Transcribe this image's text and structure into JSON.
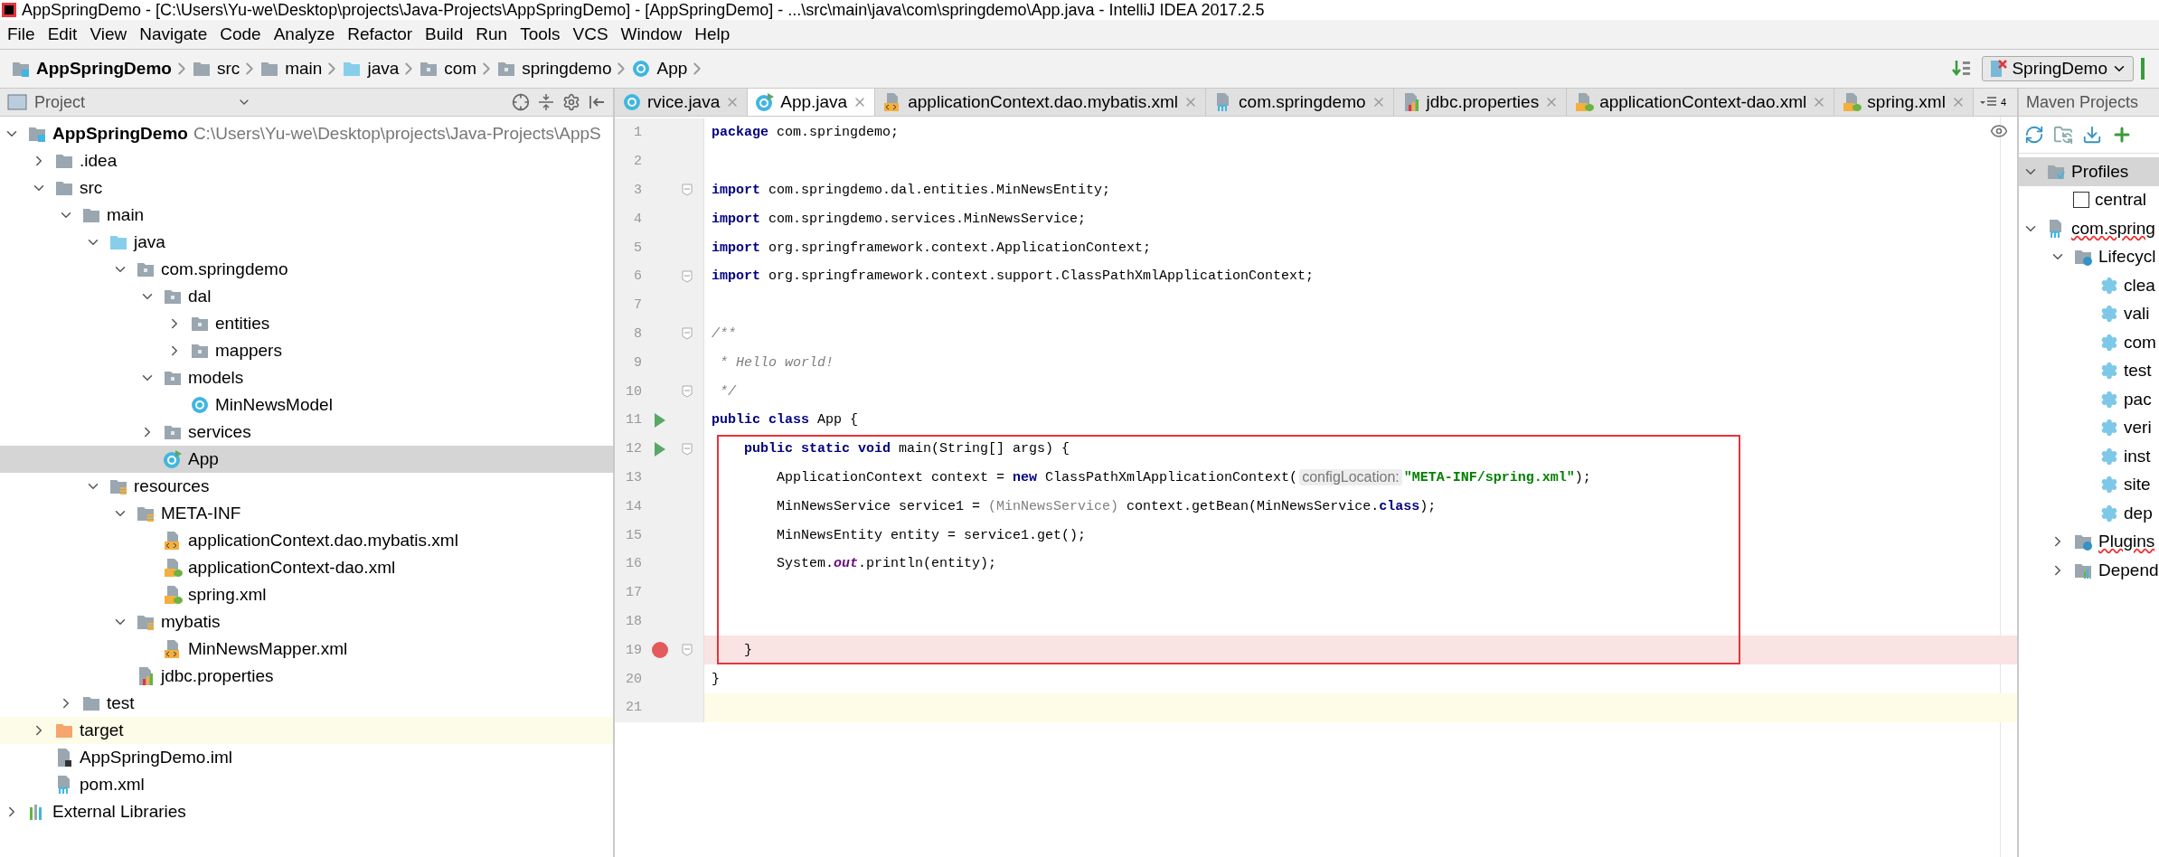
{
  "window": {
    "title": "AppSpringDemo - [C:\\Users\\Yu-we\\Desktop\\projects\\Java-Projects\\AppSpringDemo] - [AppSpringDemo] - ...\\src\\main\\java\\com\\springdemo\\App.java - IntelliJ IDEA 2017.2.5"
  },
  "menu": [
    "File",
    "Edit",
    "View",
    "Navigate",
    "Code",
    "Analyze",
    "Refactor",
    "Build",
    "Run",
    "Tools",
    "VCS",
    "Window",
    "Help"
  ],
  "breadcrumb": [
    {
      "label": "AppSpringDemo",
      "kind": "module"
    },
    {
      "label": "src",
      "kind": "folder"
    },
    {
      "label": "main",
      "kind": "folder"
    },
    {
      "label": "java",
      "kind": "source-root"
    },
    {
      "label": "com",
      "kind": "package"
    },
    {
      "label": "springdemo",
      "kind": "package"
    },
    {
      "label": "App",
      "kind": "class"
    }
  ],
  "run_config": {
    "label": "SpringDemo"
  },
  "project_panel": {
    "title": "Project",
    "tree": [
      {
        "name": "AppSpringDemo",
        "path": "C:\\Users\\Yu-we\\Desktop\\projects\\Java-Projects\\AppS",
        "kind": "module",
        "expanded": true,
        "selected": false,
        "children": [
          {
            "name": ".idea",
            "kind": "folder",
            "expanded": false,
            "selected": false
          },
          {
            "name": "src",
            "kind": "folder",
            "expanded": true,
            "selected": false,
            "children": [
              {
                "name": "main",
                "kind": "folder",
                "expanded": true,
                "selected": false,
                "children": [
                  {
                    "name": "java",
                    "kind": "source-root",
                    "expanded": true,
                    "selected": false,
                    "children": [
                      {
                        "name": "com.springdemo",
                        "kind": "package",
                        "expanded": true,
                        "selected": false,
                        "children": [
                          {
                            "name": "dal",
                            "kind": "package",
                            "expanded": true,
                            "selected": false,
                            "children": [
                              {
                                "name": "entities",
                                "kind": "package",
                                "expanded": false,
                                "selected": false
                              },
                              {
                                "name": "mappers",
                                "kind": "package",
                                "expanded": false,
                                "selected": false
                              }
                            ]
                          },
                          {
                            "name": "models",
                            "kind": "package",
                            "expanded": true,
                            "selected": false,
                            "children": [
                              {
                                "name": "MinNewsModel",
                                "kind": "class",
                                "selected": false
                              }
                            ]
                          },
                          {
                            "name": "services",
                            "kind": "package",
                            "expanded": false,
                            "selected": false
                          },
                          {
                            "name": "App",
                            "kind": "runnable-class",
                            "selected": true
                          }
                        ]
                      }
                    ]
                  },
                  {
                    "name": "resources",
                    "kind": "resource-root",
                    "expanded": true,
                    "selected": false,
                    "children": [
                      {
                        "name": "META-INF",
                        "kind": "resource-folder",
                        "expanded": true,
                        "selected": false,
                        "children": [
                          {
                            "name": "applicationContext.dao.mybatis.xml",
                            "kind": "xml",
                            "selected": false
                          },
                          {
                            "name": "applicationContext-dao.xml",
                            "kind": "spring-xml",
                            "selected": false
                          },
                          {
                            "name": "spring.xml",
                            "kind": "spring-xml",
                            "selected": false
                          }
                        ]
                      },
                      {
                        "name": "mybatis",
                        "kind": "resource-folder",
                        "expanded": true,
                        "selected": false,
                        "children": [
                          {
                            "name": "MinNewsMapper.xml",
                            "kind": "xml",
                            "selected": false
                          }
                        ]
                      },
                      {
                        "name": "jdbc.properties",
                        "kind": "properties",
                        "selected": false
                      }
                    ]
                  }
                ]
              },
              {
                "name": "test",
                "kind": "folder",
                "expanded": false,
                "selected": false
              }
            ]
          },
          {
            "name": "target",
            "kind": "excluded",
            "expanded": false,
            "selected": false
          },
          {
            "name": "AppSpringDemo.iml",
            "kind": "iml",
            "selected": false
          },
          {
            "name": "pom.xml",
            "kind": "pom",
            "selected": false
          }
        ]
      },
      {
        "name": "External Libraries",
        "kind": "libraries",
        "expanded": false,
        "selected": false
      }
    ]
  },
  "editor_tabs": [
    {
      "label": "rvice.java",
      "kind": "class",
      "selected": false
    },
    {
      "label": "App.java",
      "kind": "runnable-class",
      "selected": true
    },
    {
      "label": "applicationContext.dao.mybatis.xml",
      "kind": "xml",
      "selected": false
    },
    {
      "label": "com.springdemo",
      "kind": "pom",
      "selected": false
    },
    {
      "label": "jdbc.properties",
      "kind": "properties",
      "selected": false
    },
    {
      "label": "applicationContext-dao.xml",
      "kind": "spring-xml",
      "selected": false
    },
    {
      "label": "spring.xml",
      "kind": "spring-xml",
      "selected": false
    }
  ],
  "hidden_tabs_count": "4",
  "code": [
    {
      "number": "1",
      "tokens": [
        {
          "t": "package",
          "kind": "keyword"
        },
        {
          "t": " com.springdemo;",
          "kind": "plain"
        }
      ]
    },
    {
      "number": "2"
    },
    {
      "number": "3",
      "fold": true,
      "tokens": [
        {
          "t": "import",
          "kind": "keyword"
        },
        {
          "t": " com.springdemo.dal.entities.MinNewsEntity;",
          "kind": "plain"
        }
      ]
    },
    {
      "number": "4",
      "tokens": [
        {
          "t": "import",
          "kind": "keyword"
        },
        {
          "t": " com.springdemo.services.MinNewsService;",
          "kind": "plain"
        }
      ]
    },
    {
      "number": "5",
      "tokens": [
        {
          "t": "import",
          "kind": "keyword"
        },
        {
          "t": " org.springframework.context.ApplicationContext;",
          "kind": "plain"
        }
      ]
    },
    {
      "number": "6",
      "fold": true,
      "tokens": [
        {
          "t": "import",
          "kind": "keyword"
        },
        {
          "t": " org.springframework.context.support.ClassPathXmlApplicationContext;",
          "kind": "plain"
        }
      ]
    },
    {
      "number": "7"
    },
    {
      "number": "8",
      "fold": true,
      "tokens": [
        {
          "t": "/**",
          "kind": "comment"
        }
      ]
    },
    {
      "number": "9",
      "tokens": [
        {
          "t": " * Hello world!",
          "kind": "comment"
        }
      ]
    },
    {
      "number": "10",
      "fold": true,
      "tokens": [
        {
          "t": " */",
          "kind": "comment"
        }
      ]
    },
    {
      "number": "11",
      "run_marker": true,
      "tokens": [
        {
          "t": "public class",
          "kind": "keyword"
        },
        {
          "t": " App {",
          "kind": "plain"
        }
      ]
    },
    {
      "number": "12",
      "run_marker": true,
      "fold": true,
      "boxed": true,
      "tokens": [
        {
          "t": "    public static void",
          "kind": "keyword"
        },
        {
          "t": " main(String[] args) {",
          "kind": "plain"
        }
      ]
    },
    {
      "number": "13",
      "boxed": true,
      "tokens": [
        {
          "t": "        ApplicationContext context = ",
          "kind": "plain"
        },
        {
          "t": "new",
          "kind": "keyword"
        },
        {
          "t": " ClassPathXmlApplicationContext(",
          "kind": "plain"
        },
        {
          "t": "configLocation:",
          "kind": "hint"
        },
        {
          "t": "\"META-INF/spring.xml\"",
          "kind": "string"
        },
        {
          "t": ");",
          "kind": "plain"
        }
      ]
    },
    {
      "number": "14",
      "boxed": true,
      "tokens": [
        {
          "t": "        MinNewsService service1 = ",
          "kind": "plain"
        },
        {
          "t": "(MinNewsService)",
          "kind": "redundant"
        },
        {
          "t": " context.getBean(MinNewsService.",
          "kind": "plain"
        },
        {
          "t": "class",
          "kind": "keyword"
        },
        {
          "t": ");",
          "kind": "plain"
        }
      ]
    },
    {
      "number": "15",
      "boxed": true,
      "tokens": [
        {
          "t": "        MinNewsEntity entity = service1.get();",
          "kind": "plain"
        }
      ]
    },
    {
      "number": "16",
      "boxed": true,
      "tokens": [
        {
          "t": "        System.",
          "kind": "plain"
        },
        {
          "t": "out",
          "kind": "field"
        },
        {
          "t": ".println(entity);",
          "kind": "plain"
        }
      ]
    },
    {
      "number": "17",
      "boxed": true
    },
    {
      "number": "18",
      "boxed": true
    },
    {
      "number": "19",
      "breakpoint": true,
      "fold": true,
      "boxed": true,
      "tokens": [
        {
          "t": "    }",
          "kind": "plain"
        }
      ]
    },
    {
      "number": "20",
      "tokens": [
        {
          "t": "}",
          "kind": "plain"
        }
      ]
    },
    {
      "number": "21",
      "current_line": true
    }
  ],
  "maven_panel": {
    "title": "Maven Projects",
    "tree": [
      {
        "name": "Profiles",
        "kind": "profiles",
        "expanded": true,
        "selected": true,
        "children": [
          {
            "name": "central",
            "kind": "checkbox",
            "checked": false,
            "selected": false
          }
        ]
      },
      {
        "name": "com.spring",
        "kind": "project",
        "expanded": true,
        "selected": false,
        "error": true,
        "children": [
          {
            "name": "Lifecycl",
            "kind": "lifecycle",
            "expanded": true,
            "selected": false,
            "children": [
              {
                "name": "clea",
                "kind": "goal",
                "selected": false
              },
              {
                "name": "vali",
                "kind": "goal",
                "selected": false
              },
              {
                "name": "com",
                "kind": "goal",
                "selected": false
              },
              {
                "name": "test",
                "kind": "goal",
                "selected": false
              },
              {
                "name": "pac",
                "kind": "goal",
                "selected": false
              },
              {
                "name": "veri",
                "kind": "goal",
                "selected": false
              },
              {
                "name": "inst",
                "kind": "goal",
                "selected": false
              },
              {
                "name": "site",
                "kind": "goal",
                "selected": false
              },
              {
                "name": "dep",
                "kind": "goal",
                "selected": false
              }
            ]
          },
          {
            "name": "Plugins",
            "kind": "lifecycle",
            "expanded": false,
            "selected": false,
            "error": true
          },
          {
            "name": "Depend",
            "kind": "dependencies",
            "expanded": false,
            "selected": false
          }
        ]
      }
    ]
  }
}
